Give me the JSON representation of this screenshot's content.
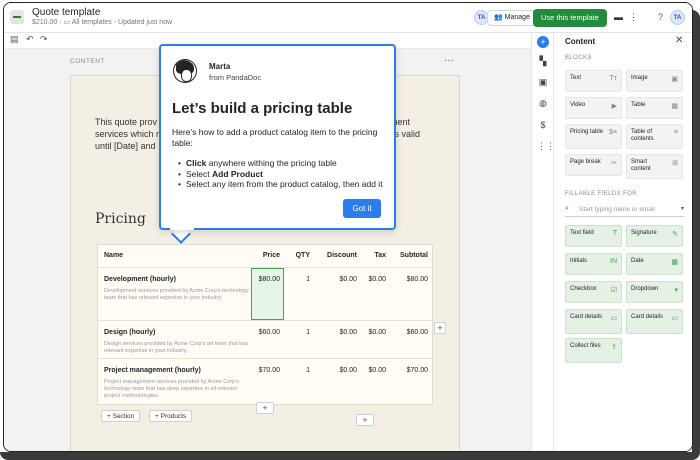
{
  "header": {
    "doc_title": "Quote template",
    "doc_price": "$210.00",
    "doc_breadcrumb": "All templates",
    "doc_status": "Updated just now",
    "avatar_initials": "TA",
    "manage_label": "Manage",
    "use_template_label": "Use this template",
    "avatar2_initials": "TA"
  },
  "canvas": {
    "top_label": "CONTENT",
    "page_text": "This quote prov... oment services which m... n is valid until [Date] and...",
    "page_text_left": "This quote prov",
    "page_text_left2": "services which m",
    "page_text_left3": "until [Date] and",
    "page_text_right": "oment",
    "page_text_right2": "n is valid",
    "section_heading": "Pricing"
  },
  "pricing_table": {
    "columns": [
      "Name",
      "Price",
      "QTY",
      "Discount",
      "Tax",
      "Subtotal"
    ],
    "rows": [
      {
        "name": "Development (hourly)",
        "desc": "Development services provided by Acme Corp's technology team that has relevant expertise in your industry.",
        "price": "$80.00",
        "qty": "1",
        "discount": "$0.00",
        "tax": "$0.00",
        "subtotal": "$80.00"
      },
      {
        "name": "Design (hourly)",
        "desc": "Design services provided by Acme Corp's art team that has relevant expertise in your industry.",
        "price": "$60.00",
        "qty": "1",
        "discount": "$0.00",
        "tax": "$0.00",
        "subtotal": "$60.00"
      },
      {
        "name": "Project management (hourly)",
        "desc": "Project management services provided by Acme Corp's technology team that has deep expertise in all relevant project methodologies.",
        "price": "$70.00",
        "qty": "1",
        "discount": "$0.00",
        "tax": "$0.00",
        "subtotal": "$70.00"
      }
    ],
    "add_section_label": "Section",
    "add_products_label": "Products"
  },
  "popover": {
    "sender_name": "Marta",
    "sender_from": "from PandaDoc",
    "title": "Let’s build a pricing table",
    "description": "Here’s how to add a product catalog item to the pricing table:",
    "steps": [
      {
        "prefix": "",
        "bold": "Click",
        "suffix": " anywhere withing the pricing table"
      },
      {
        "prefix": "Select ",
        "bold": "Add Product",
        "suffix": ""
      },
      {
        "prefix": "Select any item from the product catalog, then add it",
        "bold": "",
        "suffix": ""
      }
    ],
    "button_label": "Got it"
  },
  "panel": {
    "title": "Content",
    "blocks_label": "BLOCKS",
    "blocks": [
      {
        "label": "Text",
        "icon": "Tт"
      },
      {
        "label": "Image",
        "icon": "▣"
      },
      {
        "label": "Video",
        "icon": "▶"
      },
      {
        "label": "Table",
        "icon": "▦"
      },
      {
        "label": "Pricing table",
        "icon": "$≡"
      },
      {
        "label": "Table of contents",
        "icon": "≡"
      },
      {
        "label": "Page break",
        "icon": "✂"
      },
      {
        "label": "Smart content",
        "icon": "⊞"
      }
    ],
    "fields_label": "FILLABLE FIELDS FOR",
    "search_placeholder": "Start typing name or email",
    "fields": [
      {
        "label": "Text field",
        "icon": "T"
      },
      {
        "label": "Signature",
        "icon": "✎"
      },
      {
        "label": "Initials",
        "icon": "IN"
      },
      {
        "label": "Date",
        "icon": "▦"
      },
      {
        "label": "Checkbox",
        "icon": "☑"
      },
      {
        "label": "Dropdown",
        "icon": "▾"
      },
      {
        "label": "Card details",
        "icon": "▭"
      },
      {
        "label": "Card details",
        "icon": "▭"
      },
      {
        "label": "Collect files",
        "icon": "⇪"
      }
    ]
  }
}
